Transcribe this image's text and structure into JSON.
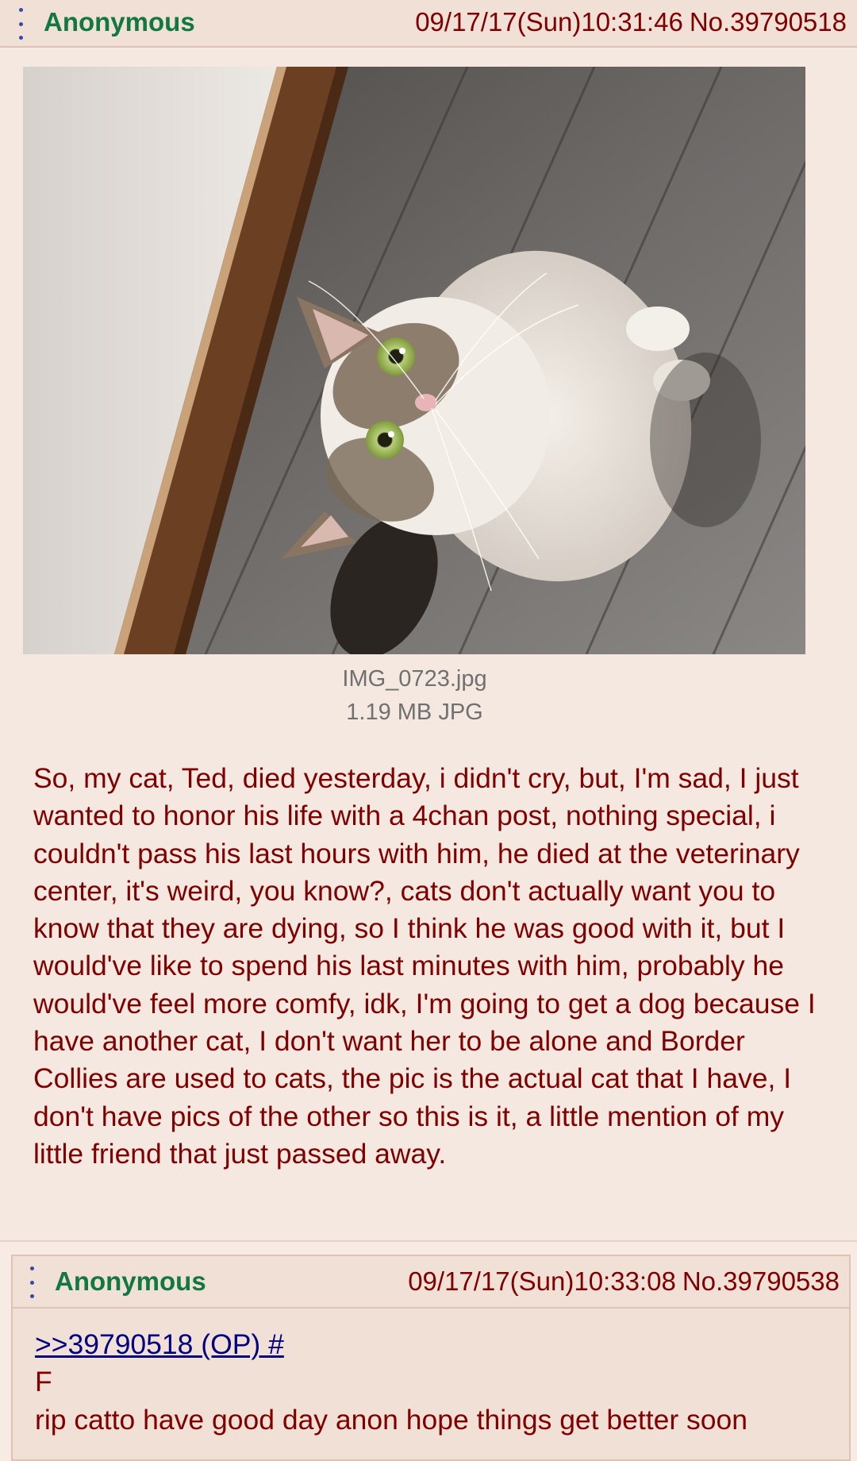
{
  "op": {
    "name": "Anonymous",
    "datetime": "09/17/17(Sun)10:31:46",
    "post_no": "No.39790518",
    "file_name": "IMG_0723.jpg",
    "file_meta": "1.19 MB JPG",
    "body": "So, my cat, Ted, died yesterday, i didn't cry, but, I'm sad, I just wanted to honor his life with a 4chan post, nothing special, i couldn't pass his last hours with him, he died at the veterinary center, it's weird, you know?, cats don't actually want you to know that they are dying, so I think he was good with it, but I would've like to spend his last minutes with him, probably he would've feel more comfy, idk, I'm going to get a dog because I have another cat, I don't want her to be alone and Border Collies are used to cats, the pic is the actual cat that I have, I don't have pics of the other so this is it, a little mention of my little friend that just passed away."
  },
  "reply": {
    "name": "Anonymous",
    "datetime": "09/17/17(Sun)10:33:08",
    "post_no": "No.39790538",
    "quote_link": ">>39790518 (OP) #",
    "lines": [
      "F",
      "rip catto have good day anon hope things get better soon"
    ]
  },
  "colors": {
    "name": "#117743",
    "text": "#800000",
    "header_bg": "#f0e0d6",
    "menu_icon": "#3449a8",
    "link": "#000080"
  },
  "icons": [
    "menu-dots-icon"
  ]
}
